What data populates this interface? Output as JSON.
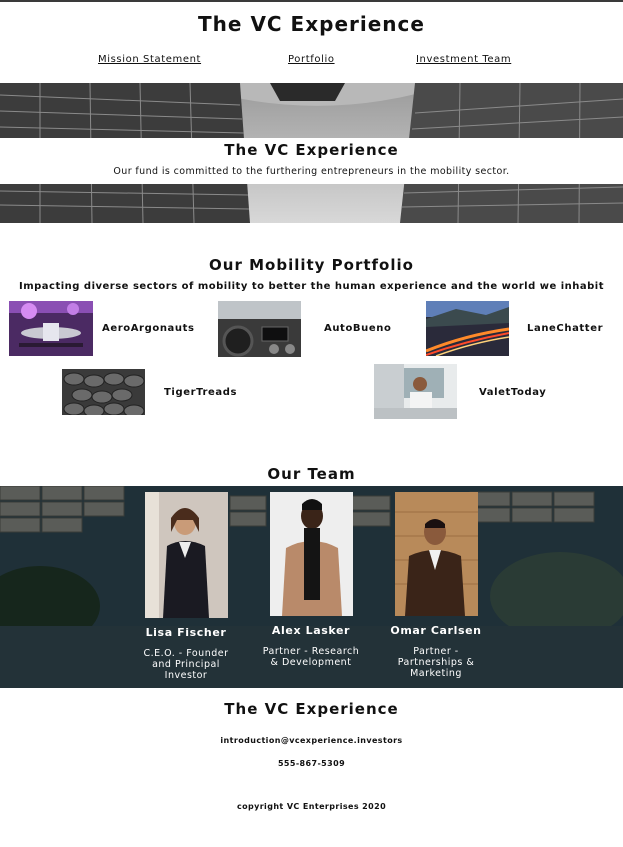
{
  "header": {
    "title": "The VC Experience",
    "nav": [
      "Mission Statement",
      "Portfolio",
      "Investment Team"
    ]
  },
  "hero": {
    "title": "The VC Experience",
    "subtitle": "Our fund is committed to the furthering entrepreneurs in the mobility sector."
  },
  "portfolio": {
    "title": "Our Mobility Portfolio",
    "subtitle": "Impacting diverse sectors of mobility to better the human experience and the world we inhabit",
    "companies": [
      "AeroArgonauts",
      "AutoBueno",
      "LaneChatter",
      "TigerTreads",
      "ValetToday"
    ]
  },
  "team": {
    "title": "Our Team",
    "members": [
      {
        "name": "Lisa Fischer",
        "role": "C.E.O. - Founder and Principal Investor"
      },
      {
        "name": "Alex Lasker",
        "role": "Partner - Research & Development"
      },
      {
        "name": "Omar Carlsen",
        "role": "Partner - Partnerships & Marketing"
      }
    ]
  },
  "footer": {
    "title": "The VC Experience",
    "email": "introduction@vcexperience.investors",
    "phone": "555-867-5309",
    "copyright": "copyright VC Enterprises 2020"
  },
  "colors": {
    "team_bg": "#1b2b33",
    "text": "#111111"
  }
}
